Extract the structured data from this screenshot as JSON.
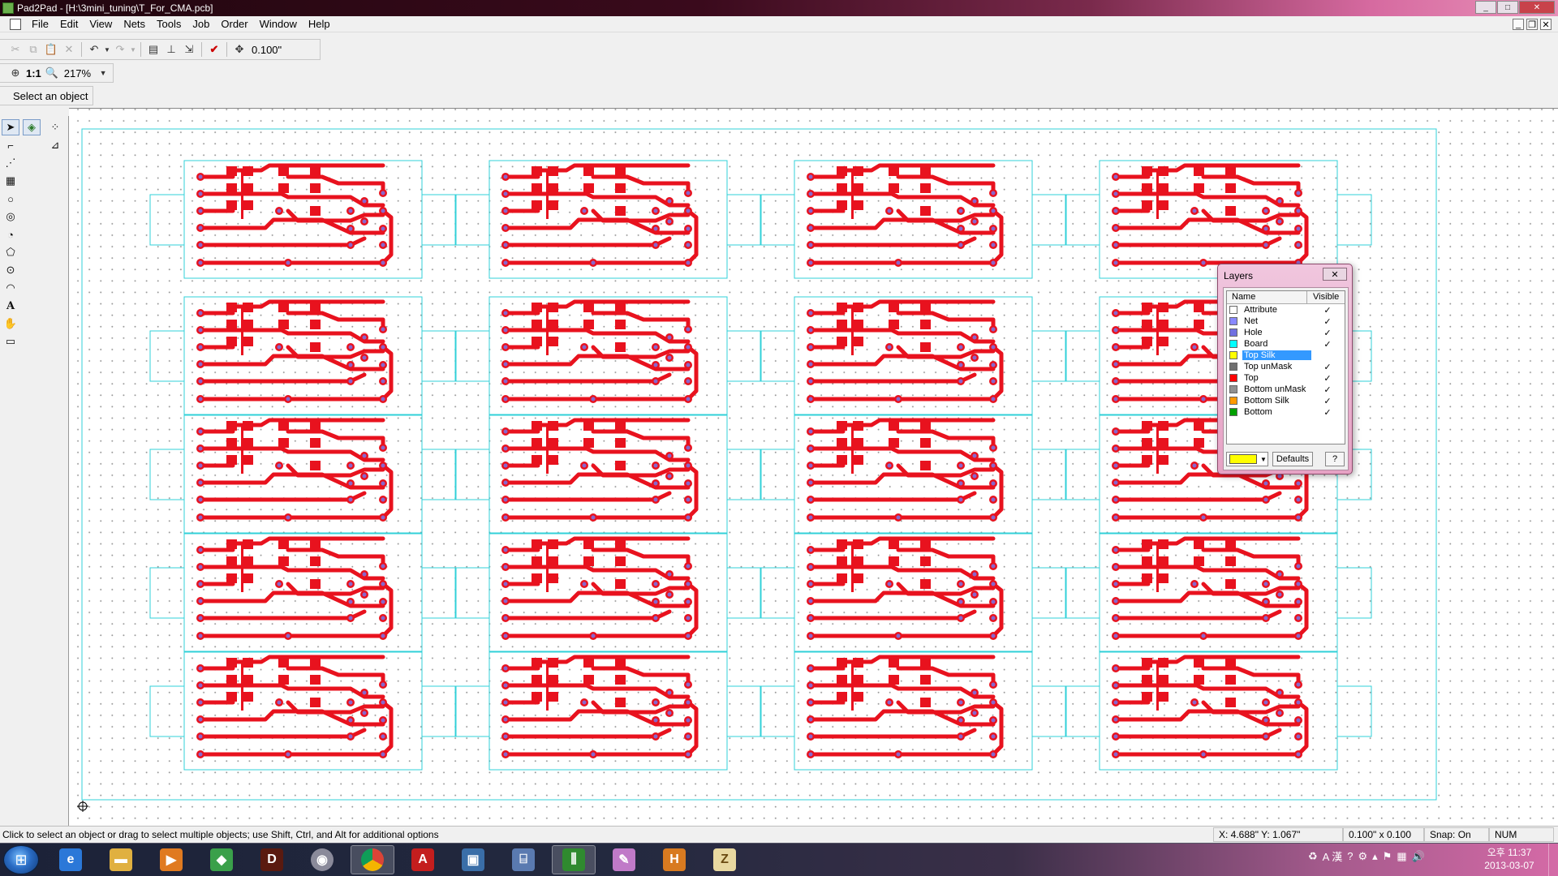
{
  "window": {
    "title": "Pad2Pad - [H:\\3mini_tuning\\T_For_CMA.pcb]",
    "controls": [
      "_",
      "□",
      "✕"
    ]
  },
  "menu": {
    "items": [
      "File",
      "Edit",
      "View",
      "Nets",
      "Tools",
      "Job",
      "Order",
      "Window",
      "Help"
    ],
    "mdi_controls": [
      "_",
      "❐",
      "✕"
    ]
  },
  "toolbar": {
    "grid_value": "0.100\"",
    "zoom_value": "217%",
    "one_to_one": "1:1",
    "hint": "Select an object"
  },
  "layers_panel": {
    "title": "Layers",
    "col_name": "Name",
    "col_visible": "Visible",
    "defaults_label": "Defaults",
    "help_label": "?",
    "current_color": "#ffff00",
    "layers": [
      {
        "name": "Attribute",
        "color": "#ffffff",
        "visible": "✓",
        "selected": false
      },
      {
        "name": "Net",
        "color": "#8888ff",
        "visible": "✓",
        "selected": false
      },
      {
        "name": "Hole",
        "color": "#7070e0",
        "visible": "✓",
        "selected": false
      },
      {
        "name": "Board",
        "color": "#00ffff",
        "visible": "✓",
        "selected": false
      },
      {
        "name": "Top Silk",
        "color": "#ffff00",
        "visible": "",
        "selected": true
      },
      {
        "name": "Top unMask",
        "color": "#707070",
        "visible": "✓",
        "selected": false
      },
      {
        "name": "Top",
        "color": "#ff0000",
        "visible": "✓",
        "selected": false
      },
      {
        "name": "Bottom unMask",
        "color": "#909090",
        "visible": "✓",
        "selected": false
      },
      {
        "name": "Bottom Silk",
        "color": "#ff9900",
        "visible": "✓",
        "selected": false
      },
      {
        "name": "Bottom",
        "color": "#00a000",
        "visible": "✓",
        "selected": false
      }
    ]
  },
  "status": {
    "message": "Click to select an object or drag to select multiple objects; use Shift, Ctrl, and Alt for additional options",
    "coords": "X: 4.688\"  Y: 1.067\"",
    "grid": "0.100\" x 0.100",
    "snap": "Snap: On",
    "num": "NUM"
  },
  "board": {
    "copper_color": "#e8121e",
    "outline_color": "#30d0d8",
    "pad_color": "#8866cc",
    "panel_columns": 4,
    "panel_rows": 5
  },
  "taskbar": {
    "apps": [
      "start",
      "ie",
      "explorer",
      "media-player",
      "windows-live",
      "diablo",
      "dvd",
      "chrome",
      "acrobat",
      "remote-desktop",
      "network",
      "pad2pad",
      "paint",
      "office",
      "archive"
    ],
    "tray_ime": "A 漢",
    "clock_ampm": "오후 11:37",
    "clock_date": "2013-03-07"
  }
}
